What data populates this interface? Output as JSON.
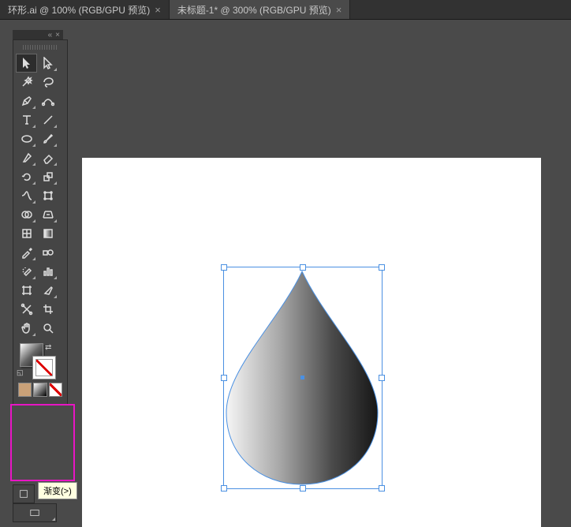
{
  "tabs": [
    {
      "label": "环形.ai @ 100% (RGB/GPU 预览)",
      "active": false
    },
    {
      "label": "未标题-1* @ 300% (RGB/GPU 预览)",
      "active": true
    }
  ],
  "toolbox": {
    "rows": [
      [
        "selection-tool",
        "direct-selection-tool"
      ],
      [
        "magic-wand-tool",
        "lasso-tool"
      ],
      [
        "pen-tool",
        "curvature-tool"
      ],
      [
        "type-tool",
        "line-tool"
      ],
      [
        "ellipse-tool",
        "paintbrush-tool"
      ],
      [
        "shaper-tool",
        "eraser-tool"
      ],
      [
        "rotate-tool",
        "scale-tool"
      ],
      [
        "width-tool",
        "free-transform-tool"
      ],
      [
        "shape-builder-tool",
        "perspective-grid-tool"
      ],
      [
        "mesh-tool",
        "gradient-tool"
      ],
      [
        "eyedropper-tool",
        "blend-tool"
      ],
      [
        "symbol-sprayer-tool",
        "column-graph-tool"
      ],
      [
        "artboard-tool",
        "slice-tool"
      ],
      [
        "puppet-warp-tool",
        "crop-tool"
      ],
      [
        "hand-tool",
        "zoom-tool"
      ]
    ]
  },
  "tooltip": "渐变(>)",
  "canvas": {
    "shape": "teardrop",
    "fill_type": "linear-gradient",
    "gradient_stops": [
      "#ffffff",
      "#1a1a1a"
    ],
    "selected": true
  },
  "highlight_area": "fill-stroke-and-swatches"
}
